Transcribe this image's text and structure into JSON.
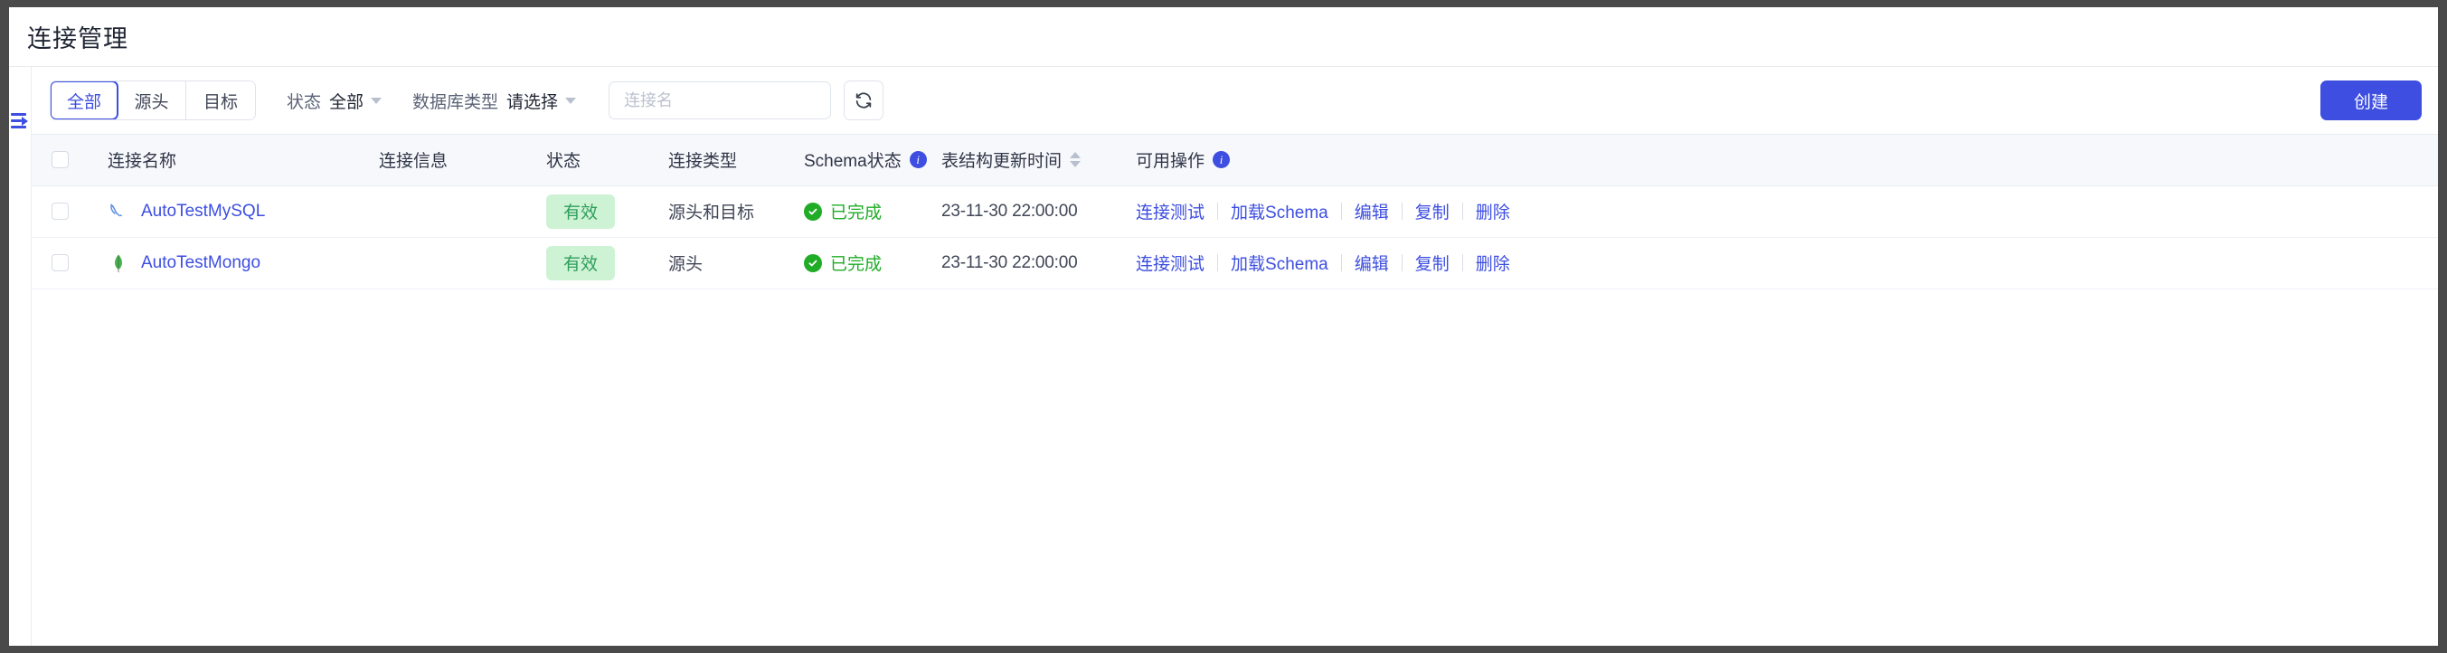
{
  "window": {
    "title": "连接管理"
  },
  "rail": {
    "toggle_icon": "sidebar-expand-icon"
  },
  "toolbar": {
    "segments": [
      {
        "label": "全部",
        "active": true
      },
      {
        "label": "源头",
        "active": false
      },
      {
        "label": "目标",
        "active": false
      }
    ],
    "filters": [
      {
        "label": "状态",
        "value": "全部"
      },
      {
        "label": "数据库类型",
        "value": "请选择"
      }
    ],
    "search": {
      "placeholder": "连接名",
      "value": ""
    },
    "refresh_icon": "refresh-icon",
    "create_label": "创建"
  },
  "table": {
    "columns": [
      {
        "key": "checkbox",
        "label": ""
      },
      {
        "key": "name",
        "label": "连接名称"
      },
      {
        "key": "info",
        "label": "连接信息"
      },
      {
        "key": "state",
        "label": "状态"
      },
      {
        "key": "type",
        "label": "连接类型"
      },
      {
        "key": "schema",
        "label": "Schema状态",
        "info": true
      },
      {
        "key": "time",
        "label": "表结构更新时间",
        "sortable": true
      },
      {
        "key": "ops",
        "label": "可用操作",
        "info": true
      }
    ],
    "rows": [
      {
        "name": "AutoTestMySQL",
        "db_icon": "mysql-dolphin-icon",
        "info": "",
        "info_redacted": true,
        "state": "有效",
        "type": "源头和目标",
        "schema_status": "已完成",
        "updated_at": "23-11-30 22:00:00",
        "operations": [
          "连接测试",
          "加载Schema",
          "编辑",
          "复制",
          "删除"
        ]
      },
      {
        "name": "AutoTestMongo",
        "db_icon": "mongodb-leaf-icon",
        "info": "",
        "info_redacted": true,
        "state": "有效",
        "type": "源头",
        "schema_status": "已完成",
        "updated_at": "23-11-30 22:00:00",
        "operations": [
          "连接测试",
          "加载Schema",
          "编辑",
          "复制",
          "删除"
        ]
      }
    ]
  },
  "colors": {
    "accent": "#3d4ee0",
    "success": "#20ac27",
    "badge_bg": "#cdf2d4",
    "badge_text": "#2f9e5b"
  }
}
